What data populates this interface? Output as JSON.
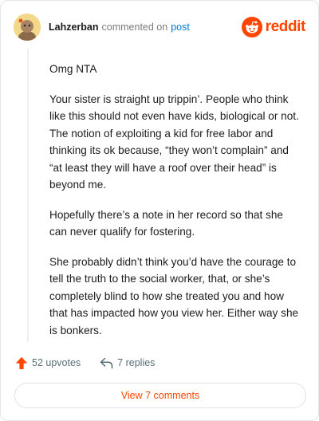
{
  "header": {
    "username": "Lahzerban",
    "action_text": "commented on",
    "post_link": "post",
    "brand_word": "reddit"
  },
  "comment": {
    "paragraphs": [
      "Omg NTA",
      "Your sister is straight up trippin’. People who think like this should not even have kids, biological or not. The notion of exploiting a kid for free labor and thinking its ok because, “they won’t complain” and “at least they will have a roof over their head” is beyond me.",
      "Hopefully there’s a note in her record so that she can never qualify for fostering.",
      "She probably didn’t think you’d have the courage to tell the truth to the social worker, that, or she’s completely blind to how she treated you and how that has impacted how you view her. Either way she is bonkers."
    ]
  },
  "actions": {
    "upvotes": "52 upvotes",
    "replies": "7 replies",
    "view_comments": "View 7 comments"
  },
  "icons": {
    "avatar": "avatar-icon",
    "brand": "reddit-logo-icon",
    "upvote": "upvote-arrow-icon",
    "reply": "reply-arrow-icon"
  },
  "colors": {
    "brand": "#ff4500",
    "link": "#0079d3",
    "muted": "#7c7c7c",
    "action_gray": "#576f76"
  }
}
